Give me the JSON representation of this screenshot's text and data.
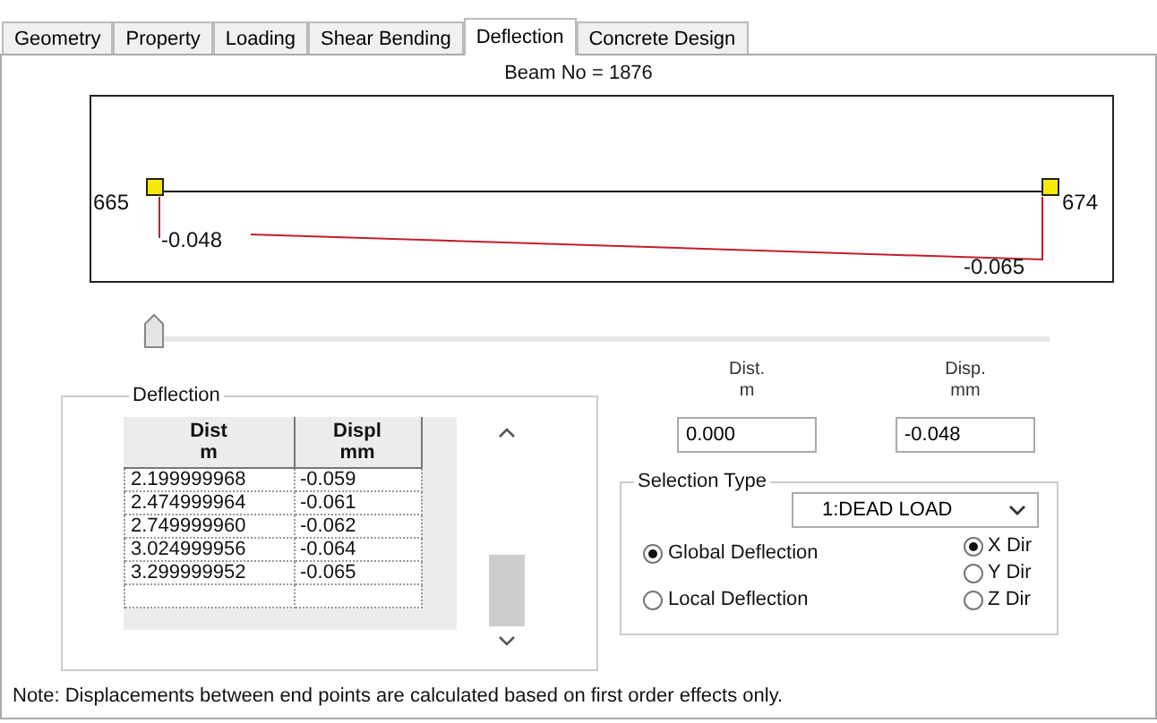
{
  "tabs": [
    {
      "label": "Geometry",
      "selected": false
    },
    {
      "label": "Property",
      "selected": false
    },
    {
      "label": "Loading",
      "selected": false
    },
    {
      "label": "Shear Bending",
      "selected": false
    },
    {
      "label": "Deflection",
      "selected": true
    },
    {
      "label": "Concrete Design",
      "selected": false
    }
  ],
  "beam_label": "Beam No = 1876",
  "diagram": {
    "start_node": "665",
    "end_node": "674",
    "start_value": "-0.048",
    "end_value": "-0.065"
  },
  "slider": {
    "level": 0
  },
  "deflection": {
    "title": "Deflection",
    "columns": [
      {
        "name": "Dist",
        "unit": "m"
      },
      {
        "name": "Displ",
        "unit": "mm"
      }
    ],
    "rows": [
      [
        "2.199999968",
        "-0.059"
      ],
      [
        "2.474999964",
        "-0.061"
      ],
      [
        "2.749999960",
        "-0.062"
      ],
      [
        "3.024999956",
        "-0.064"
      ],
      [
        "3.299999952",
        "-0.065"
      ]
    ]
  },
  "fields": [
    {
      "label": "Dist.",
      "unit": "m",
      "value": "0.000"
    },
    {
      "label": "Disp.",
      "unit": "mm",
      "value": "-0.048"
    }
  ],
  "selection_type": {
    "title": "Selection Type",
    "load_case": "1:DEAD LOAD",
    "deflection_options": [
      {
        "label": "Global Deflection",
        "selected": true
      },
      {
        "label": "Local Deflection",
        "selected": false
      }
    ],
    "direction_options": [
      {
        "label": "X Dir",
        "selected": true
      },
      {
        "label": "Y Dir",
        "selected": false
      },
      {
        "label": "Z Dir",
        "selected": false
      }
    ]
  },
  "note": "Note: Displacements between end points are calculated based on first order effects only."
}
